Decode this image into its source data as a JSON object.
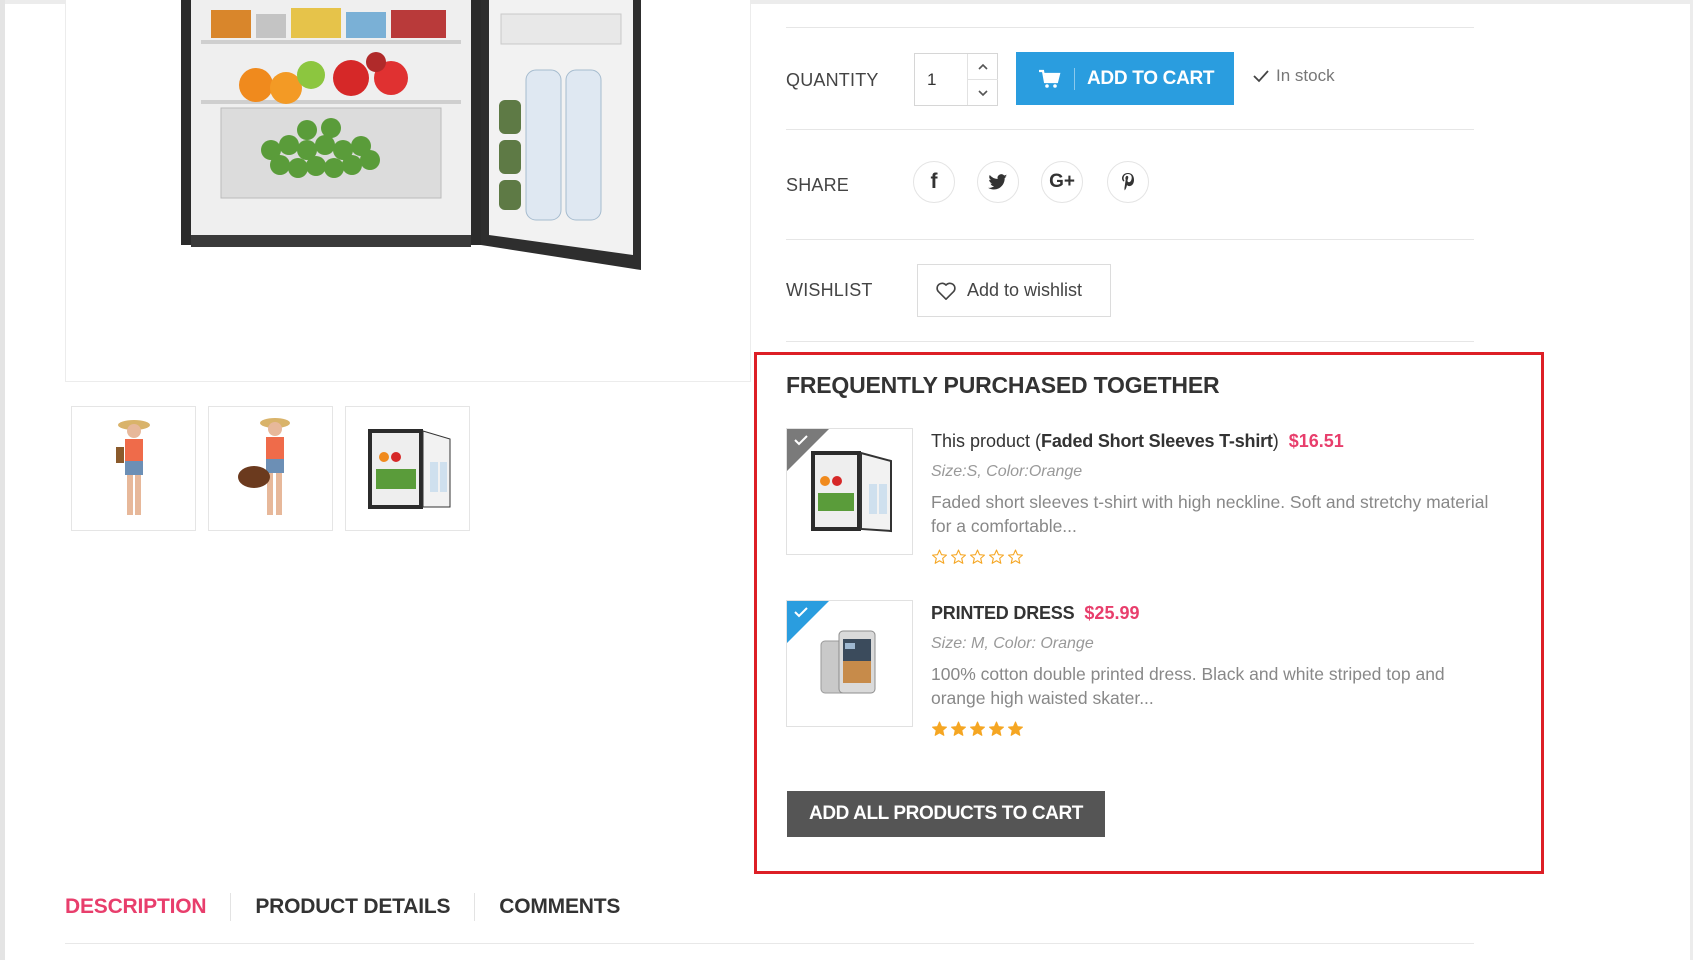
{
  "product_actions": {
    "quantity_label": "QUANTITY",
    "quantity_value": "1",
    "add_to_cart_label": "ADD TO CART",
    "stock_status": "In stock",
    "share_label": "SHARE",
    "wishlist_label": "WISHLIST",
    "add_to_wishlist_label": "Add to wishlist"
  },
  "share_buttons": [
    {
      "icon": "facebook-icon",
      "glyph": "f"
    },
    {
      "icon": "twitter-icon",
      "glyph": "t"
    },
    {
      "icon": "google-plus-icon",
      "glyph": "G+"
    },
    {
      "icon": "pinterest-icon",
      "glyph": "P"
    }
  ],
  "frequently_purchased": {
    "title": "FREQUENTLY PURCHASED TOGETHER",
    "items": [
      {
        "prefix": "This product (",
        "name": "Faded Short Sleeves T-shirt",
        "suffix": ")",
        "price": "$16.51",
        "attributes": "Size:S, Color:Orange",
        "description": "Faded short sleeves t-shirt with high neckline. Soft and stretchy material for a comfortable...",
        "rating": 0,
        "checked_color": "#7a7a7a"
      },
      {
        "prefix": "",
        "name": "PRINTED DRESS",
        "suffix": "",
        "price": "$25.99",
        "attributes": "Size: M, Color: Orange",
        "description": "100% cotton double printed dress. Black and white striped top and orange high waisted skater...",
        "rating": 5,
        "checked_color": "#2a9ddf"
      }
    ],
    "add_all_label": "ADD ALL PRODUCTS TO CART"
  },
  "tabs": [
    {
      "label": "DESCRIPTION",
      "active": true
    },
    {
      "label": "PRODUCT DETAILS",
      "active": false
    },
    {
      "label": "COMMENTS",
      "active": false
    }
  ],
  "colors": {
    "accent_blue": "#2a9ddf",
    "price_pink": "#e83e6c",
    "highlight_red": "#dd1f26",
    "star_gold": "#f5a623",
    "dark_button": "#555555"
  }
}
